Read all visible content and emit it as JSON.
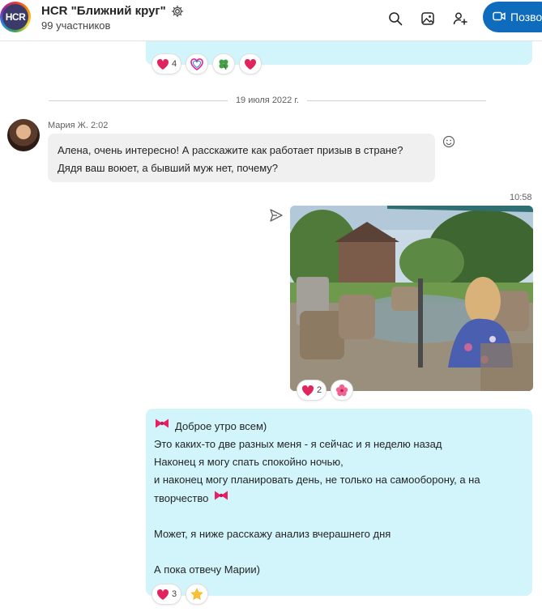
{
  "header": {
    "avatar_text": "HCR",
    "title": "HCR \"Ближний круг\"",
    "subtitle": "99 участников",
    "call_label": "Позво"
  },
  "top_message": {
    "reactions": [
      {
        "icon": "heart-icon",
        "count": "4"
      },
      {
        "icon": "love-letter-icon",
        "count": ""
      },
      {
        "icon": "clover-icon",
        "count": ""
      },
      {
        "icon": "heart-icon",
        "count": ""
      }
    ]
  },
  "date_separator": "19 июля 2022 г.",
  "maria_message": {
    "sender": "Мария Ж. 2:02",
    "lines": [
      "Алена, очень интересно! А расскажите как работает призыв в стране?",
      "Дядя ваш воюет, а бывший муж нет, почему?"
    ]
  },
  "photo_message": {
    "time": "10:58",
    "reactions": [
      {
        "icon": "heart-icon",
        "count": "2"
      },
      {
        "icon": "hibiscus-icon",
        "count": ""
      }
    ]
  },
  "text_message": {
    "lines": [
      "Доброе утро всем)",
      "Это каких-то две разных меня - я сейчас и я неделю назад",
      "Наконец я могу спать спокойно ночью,",
      "и наконец могу планировать день, не только на самооборону, а на",
      "творчество",
      "",
      "Может, я ниже расскажу анализ вчерашнего дня",
      "",
      "А пока отвечу Марии)"
    ],
    "reactions": [
      {
        "icon": "heart-icon",
        "count": "3"
      },
      {
        "icon": "star-icon",
        "count": ""
      }
    ]
  },
  "colors": {
    "accent": "#0f6cbd",
    "outgoing_bubble": "#d1f5fb",
    "incoming_bubble": "#f0f0f0",
    "heart": "#e0245e"
  }
}
